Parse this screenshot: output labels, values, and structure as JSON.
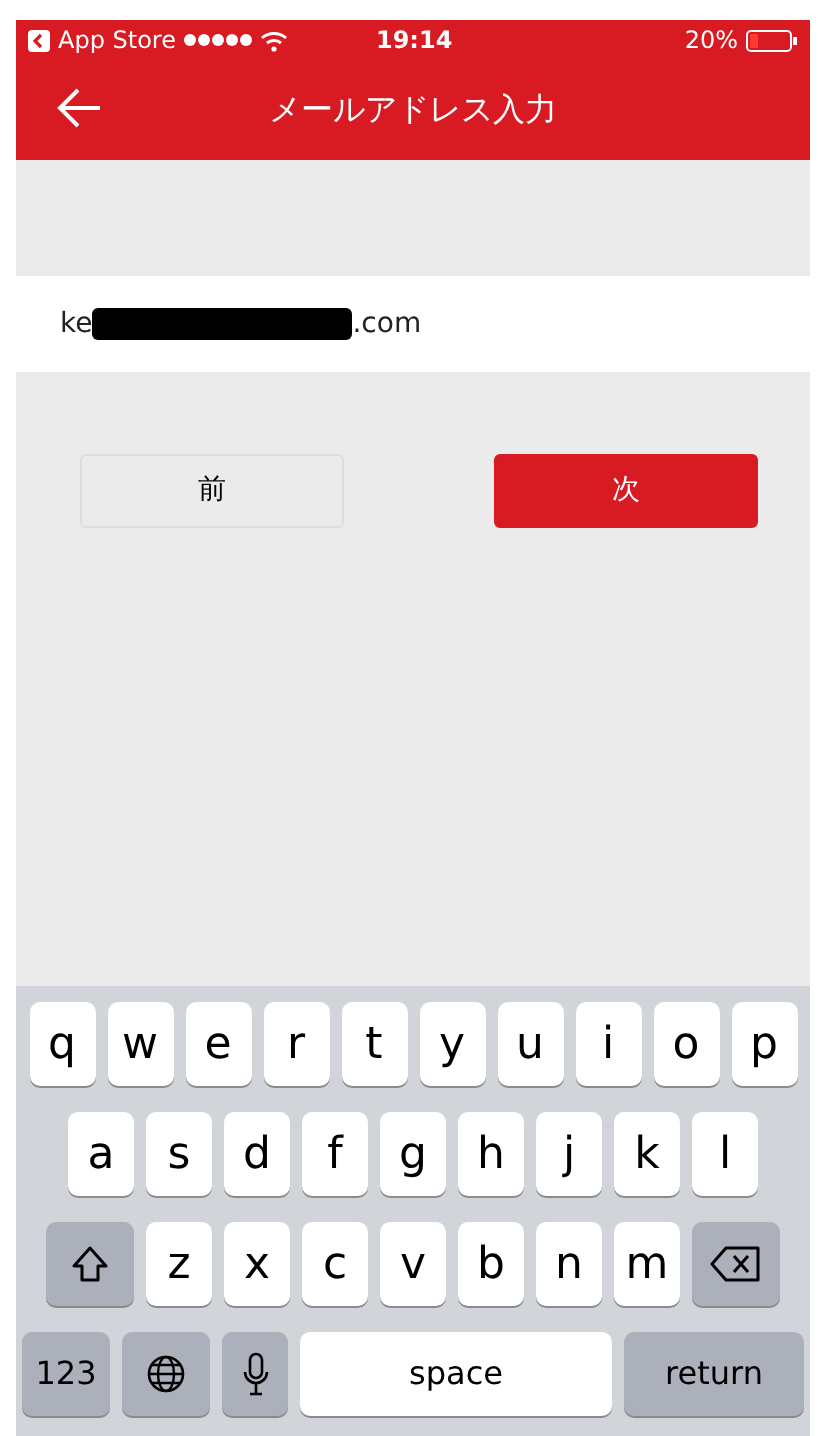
{
  "status_bar": {
    "back_label": "App Store",
    "time": "19:14",
    "battery": "20%"
  },
  "nav": {
    "title": "メールアドレス入力"
  },
  "email_field": {
    "value_start": "ke",
    "redacted": true,
    "value_end": ".com"
  },
  "buttons": [
    {
      "label": "前",
      "kind": "secondary"
    },
    {
      "label": "次",
      "kind": "primary"
    }
  ],
  "keyboard": {
    "top_row": [
      {
        "kind": "letter",
        "label": "q"
      },
      {
        "kind": "letter",
        "label": "w"
      },
      {
        "kind": "letter",
        "label": "e"
      },
      {
        "kind": "letter",
        "label": "r"
      },
      {
        "kind": "letter",
        "label": "t"
      },
      {
        "kind": "letter",
        "label": "y"
      },
      {
        "kind": "letter",
        "label": "u"
      },
      {
        "kind": "letter",
        "label": "i"
      },
      {
        "kind": "letter",
        "label": "o"
      },
      {
        "kind": "letter",
        "label": "p"
      }
    ],
    "middle_row": [
      {
        "kind": "letter",
        "label": "a"
      },
      {
        "kind": "letter",
        "label": "s"
      },
      {
        "kind": "letter",
        "label": "d"
      },
      {
        "kind": "letter",
        "label": "f"
      },
      {
        "kind": "letter",
        "label": "g"
      },
      {
        "kind": "letter",
        "label": "h"
      },
      {
        "kind": "letter",
        "label": "j"
      },
      {
        "kind": "letter",
        "label": "k"
      },
      {
        "kind": "letter",
        "label": "l"
      }
    ],
    "lower_row": [
      {
        "kind": "shift"
      },
      {
        "kind": "letter",
        "label": "z"
      },
      {
        "kind": "letter",
        "label": "x"
      },
      {
        "kind": "letter",
        "label": "c"
      },
      {
        "kind": "letter",
        "label": "v"
      },
      {
        "kind": "letter",
        "label": "b"
      },
      {
        "kind": "letter",
        "label": "n"
      },
      {
        "kind": "letter",
        "label": "m"
      },
      {
        "kind": "backspace"
      }
    ],
    "bottom_row": [
      {
        "kind": "mode",
        "label": "123"
      },
      {
        "kind": "globe"
      },
      {
        "kind": "mic"
      },
      {
        "kind": "space",
        "label": "space"
      },
      {
        "kind": "return",
        "label": "return"
      }
    ]
  }
}
